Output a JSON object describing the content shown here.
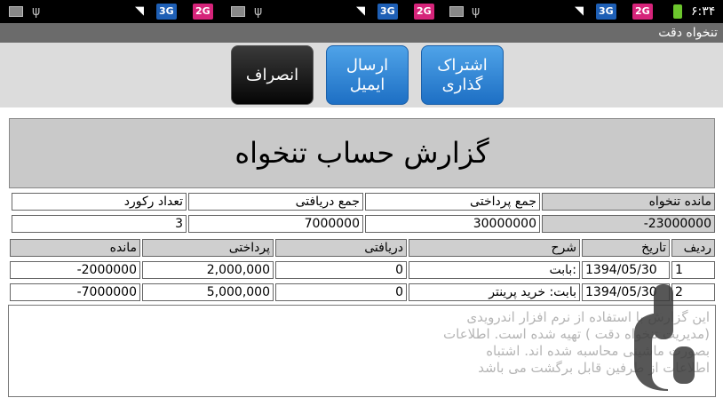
{
  "status_bar": {
    "time": "۶:۳۴",
    "badge_3g": "3G",
    "badge_2g": "2G",
    "battery_color": "#6cc62d"
  },
  "window": {
    "title": "تنخواه دقت"
  },
  "toolbar": {
    "share_label_line1": "اشتراک",
    "share_label_line2": "گذاری",
    "email_label_line1": "ارسال",
    "email_label_line2": "ایمیل",
    "cancel_label": "انصراف"
  },
  "report": {
    "title": "گزارش حساب تنخواه",
    "summary_headers": [
      "مانده تنخواه",
      "جمع پرداختی",
      "جمع دریافتی",
      "تعداد رکورد"
    ],
    "summary_values": [
      "-23000000",
      "30000000",
      "7000000",
      "3"
    ]
  },
  "table": {
    "headers": [
      "ردیف",
      "تاریخ",
      "شرح",
      "دریافتی",
      "پرداختی",
      "مانده"
    ],
    "rows": [
      {
        "index": "1",
        "date": "1394/05/30",
        "description": "بابت:",
        "received": "0",
        "paid": "2,000,000",
        "balance": "-2000000"
      },
      {
        "index": "2",
        "date": "1394/05/30",
        "description": "بابت: خرید پرینتر",
        "received": "0",
        "paid": "5,000,000",
        "balance": "-7000000"
      }
    ]
  },
  "footer": {
    "text": "این گزارش با استفاده از نرم افزار اندرویدی (مدیریت تنخواه دقت ) تهیه شده است. اطلاعات بصورت ماشینی محاسبه شده اند. اشتباه اطلاعات از طرفین قابل برگشت می باشد"
  }
}
